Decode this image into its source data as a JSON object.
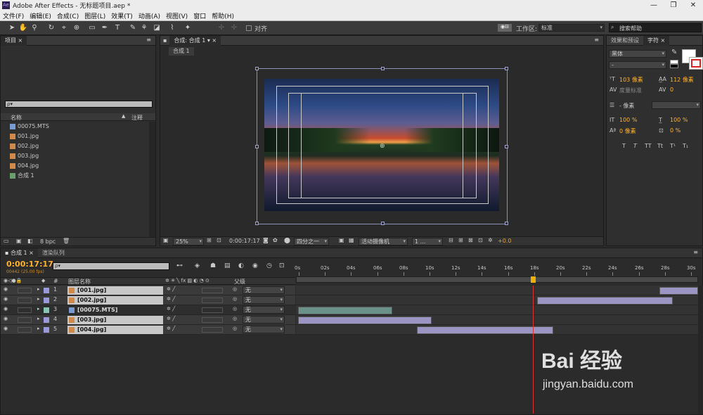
{
  "window": {
    "app_icon": "Ae",
    "title": "Adobe After Effects - 无标题项目.aep *",
    "min": "—",
    "max": "❐",
    "close": "✕"
  },
  "menu": [
    "文件(F)",
    "编辑(E)",
    "合成(C)",
    "图层(L)",
    "效果(T)",
    "动画(A)",
    "视图(V)",
    "窗口",
    "帮助(H)"
  ],
  "toolbar": {
    "align_label": "对齐",
    "workspace_label": "工作区:",
    "workspace_value": "标准",
    "search_placeholder": "搜索帮助"
  },
  "project": {
    "tab": "项目",
    "search_placeholder": "ρ▾",
    "col_name": "名称",
    "col_comment": "注释",
    "items": [
      {
        "name": "00075.MTS",
        "type": "video"
      },
      {
        "name": "001.jpg",
        "type": "image"
      },
      {
        "name": "002.jpg",
        "type": "image"
      },
      {
        "name": "003.jpg",
        "type": "image"
      },
      {
        "name": "004.jpg",
        "type": "image"
      },
      {
        "name": "合成 1",
        "type": "comp"
      }
    ],
    "bpc": "8 bpc"
  },
  "composition": {
    "tab": "合成: 合成 1",
    "subtab": "合成 1",
    "zoom": "25%",
    "timecode": "0:00:17:17",
    "resolution": "四分之一",
    "camera": "活动摄像机",
    "views": "1 ...",
    "exposure": "+0.0"
  },
  "right_panels": {
    "tab_effects": "效果和预设",
    "tab_char": "字符",
    "font": "黑体",
    "style": "-",
    "size": "103 像素",
    "leading": "112 像素",
    "kerning": "度量标准",
    "tracking": "0",
    "stroke_px": "- 像素",
    "vscale": "100 %",
    "hscale": "100 %",
    "baseline": "0 像素",
    "tsume": "0 %",
    "styles": [
      "T",
      "T",
      "TT",
      "Tt",
      "T¹",
      "T₁"
    ]
  },
  "timeline": {
    "tab_comp": "合成 1",
    "tab_render": "渲染队列",
    "timecode": "0:00:17:17",
    "frame_info": "00442 (25.00 fps)",
    "search_placeholder": "ρ▾",
    "col_num": "#",
    "col_layer": "图层名称",
    "col_parent": "父级",
    "ruler": [
      "0s",
      "02s",
      "04s",
      "06s",
      "08s",
      "10s",
      "12s",
      "14s",
      "16s",
      "18s",
      "20s",
      "22s",
      "24s",
      "26s",
      "28s",
      "30s"
    ],
    "playhead_fraction": 0.589,
    "layers": [
      {
        "num": "1",
        "name": "[001.jpg]",
        "parent": "无",
        "label_color": "#9a9ad8",
        "start": 0.903,
        "end": 1.0,
        "bar_color": "#9a95c2"
      },
      {
        "num": "2",
        "name": "[002.jpg]",
        "parent": "无",
        "label_color": "#9a9ad8",
        "start": 0.6,
        "end": 0.938,
        "bar_color": "#9a95c2"
      },
      {
        "num": "3",
        "name": "[00075.MTS]",
        "parent": "无",
        "label_color": "#88c4b4",
        "start": 0.005,
        "end": 0.24,
        "bar_color": "#6b9288"
      },
      {
        "num": "4",
        "name": "[003.jpg]",
        "parent": "无",
        "label_color": "#9a9ad8",
        "start": 0.005,
        "end": 0.338,
        "bar_color": "#9a95c2"
      },
      {
        "num": "5",
        "name": "[004.jpg]",
        "parent": "无",
        "label_color": "#9a9ad8",
        "start": 0.3,
        "end": 0.64,
        "bar_color": "#9a95c2"
      }
    ]
  },
  "watermark": {
    "brand": "Bai 经验",
    "url": "jingyan.baidu.com"
  }
}
